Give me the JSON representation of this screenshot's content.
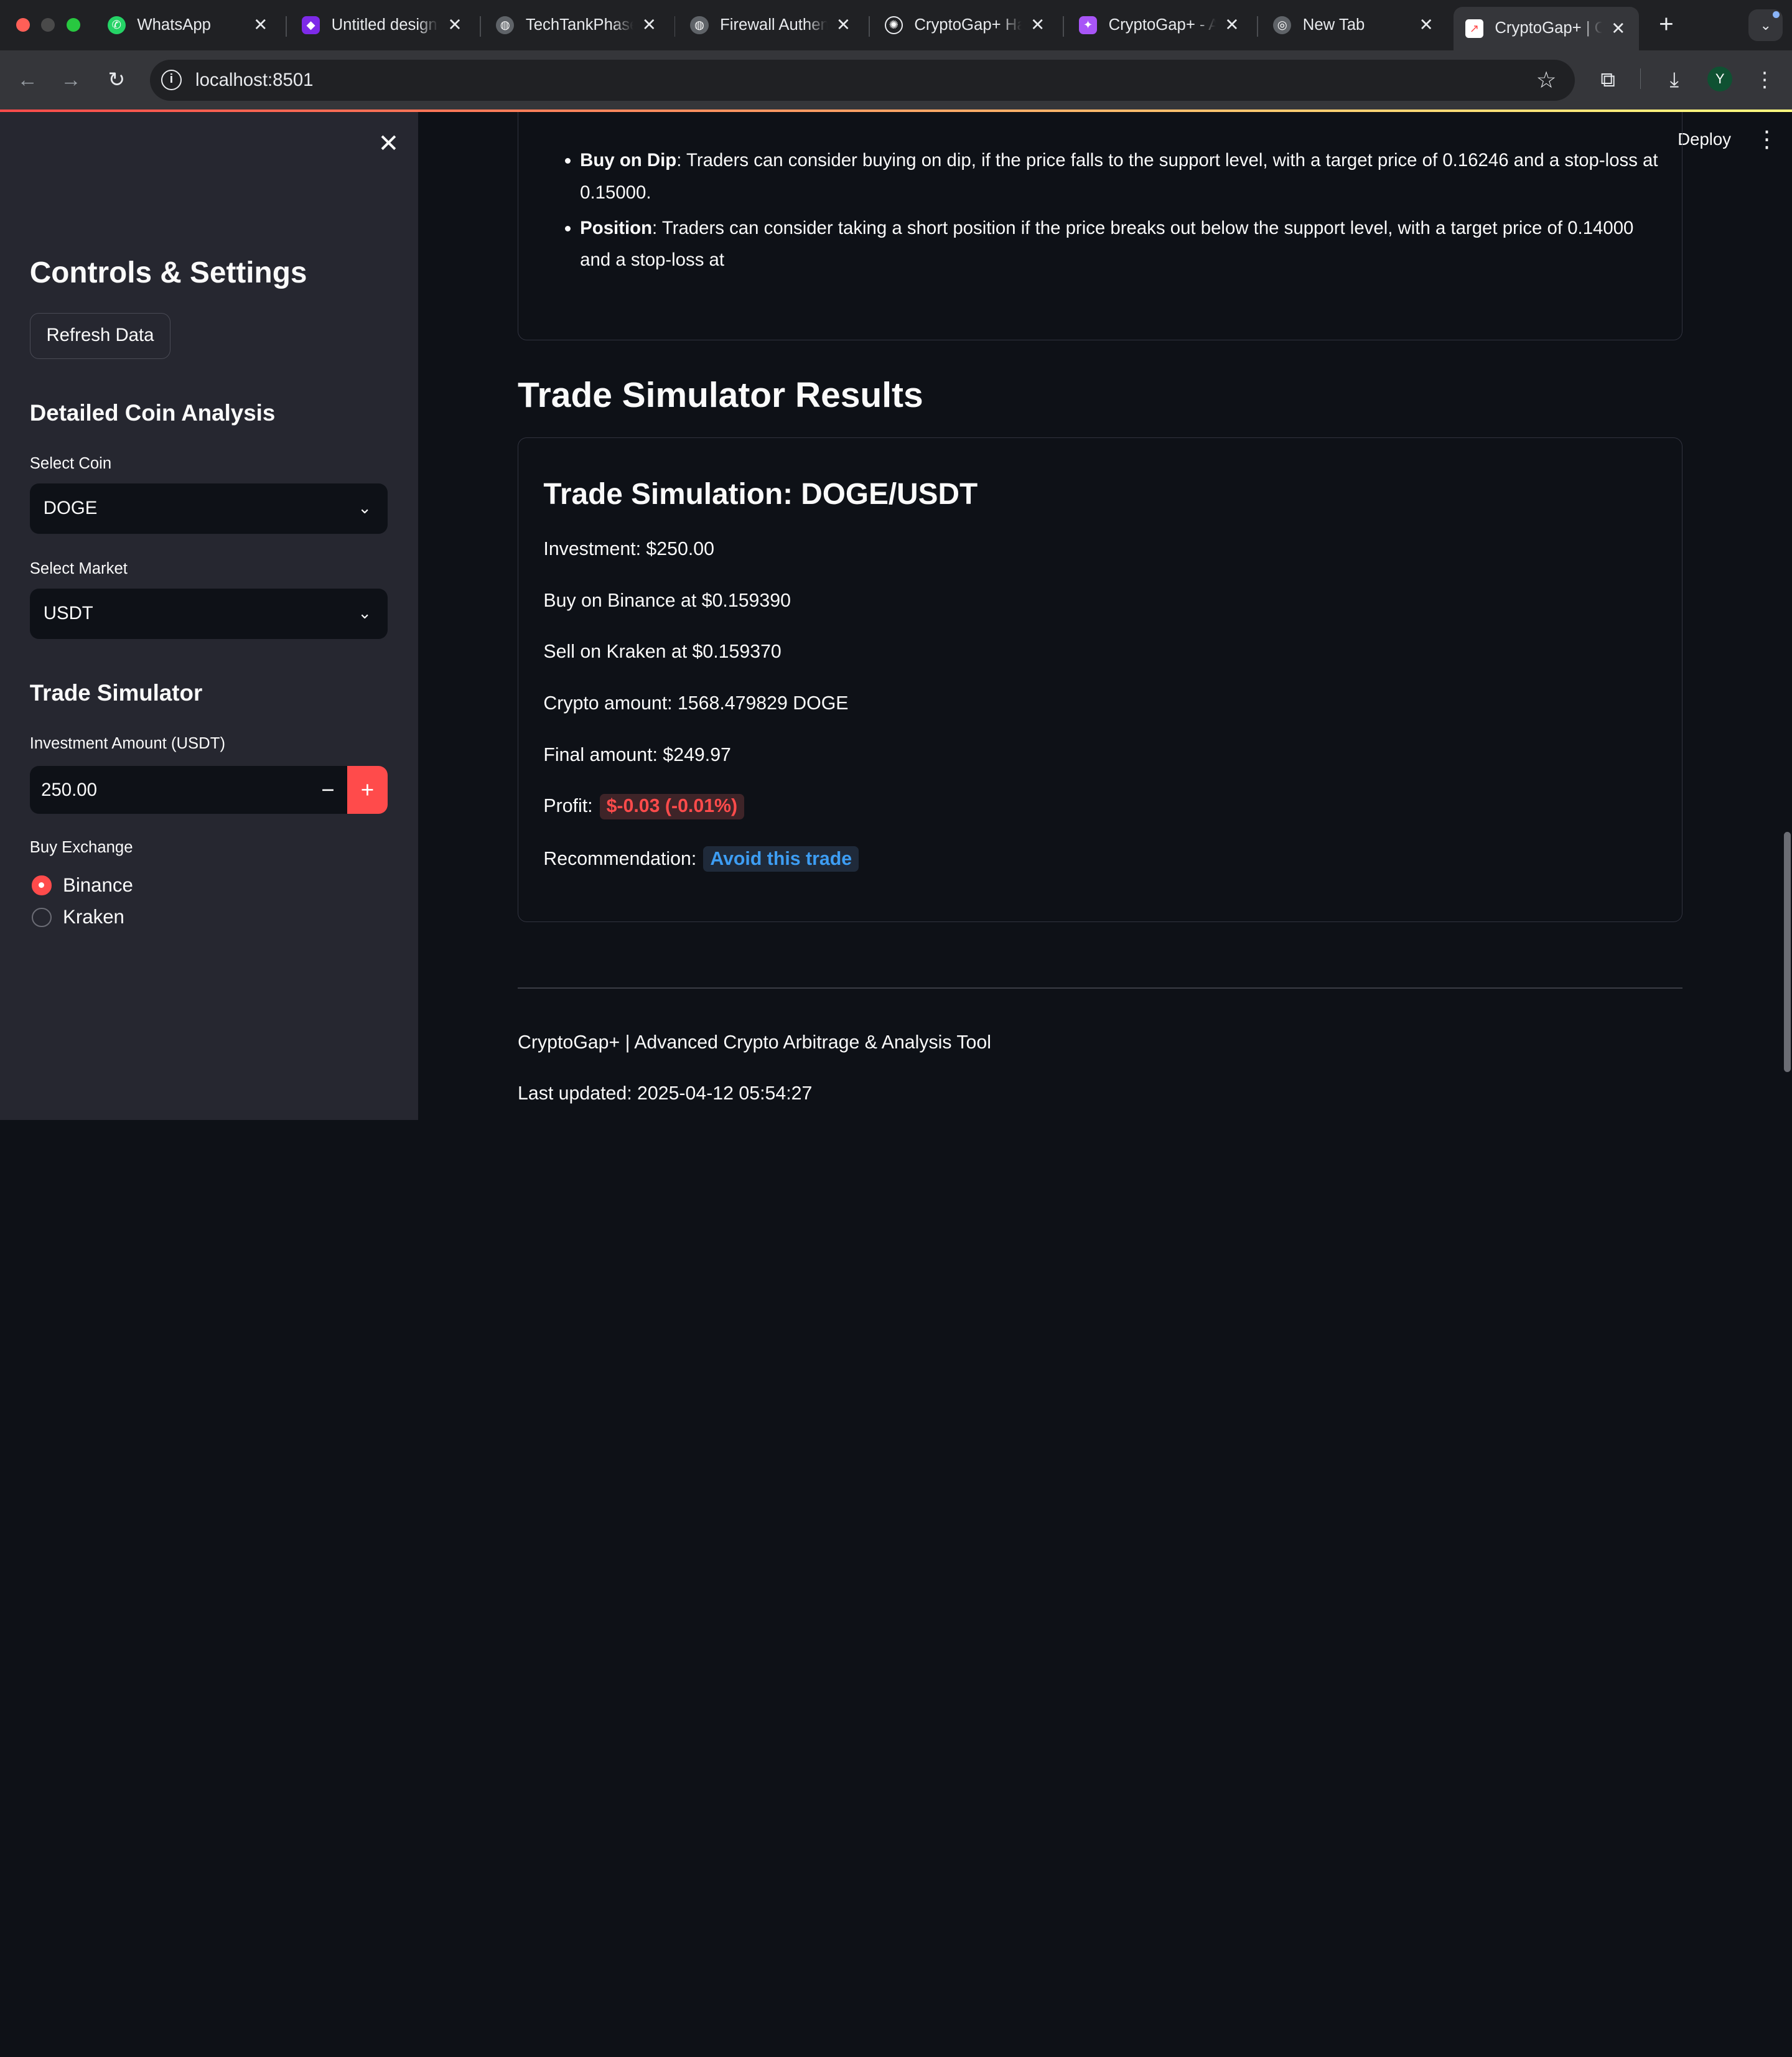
{
  "browser": {
    "tabs": [
      {
        "title": "WhatsApp",
        "icon": "whatsapp-icon",
        "color": "#25d366"
      },
      {
        "title": "Untitled design",
        "icon": "canva-icon",
        "color": "#7d2ae8"
      },
      {
        "title": "TechTankPhase",
        "icon": "globe-icon",
        "color": "#9aa0a6"
      },
      {
        "title": "Firewall Authen",
        "icon": "globe-icon",
        "color": "#9aa0a6"
      },
      {
        "title": "CryptoGap+ Ha",
        "icon": "openai-icon",
        "color": "#e8eaed"
      },
      {
        "title": "CryptoGap+ - A",
        "icon": "claude-icon",
        "color": "#a855f7"
      },
      {
        "title": "New Tab",
        "icon": "chrome-icon",
        "color": "#9aa0a6"
      },
      {
        "title": "CryptoGap+ | C",
        "icon": "chart-icon",
        "color": "#ff4b4b"
      }
    ],
    "url": "localhost:8501",
    "profile_initial": "Y"
  },
  "sidebar": {
    "title": "Controls & Settings",
    "refresh_label": "Refresh Data",
    "analysis_title": "Detailed Coin Analysis",
    "coin_label": "Select Coin",
    "coin_value": "DOGE",
    "market_label": "Select Market",
    "market_value": "USDT",
    "sim_title": "Trade Simulator",
    "investment_label": "Investment Amount (USDT)",
    "investment_value": "250.00",
    "buy_exchange_label": "Buy Exchange",
    "exchanges": [
      "Binance",
      "Kraken"
    ],
    "selected_exchange": "Binance"
  },
  "header": {
    "deploy_label": "Deploy"
  },
  "analysis": {
    "bullets": [
      {
        "label": "Buy on Dip",
        "text": ": Traders can consider buying on dip, if the price falls to the support level, with a target price of 0.16246 and a stop-loss at 0.15000."
      },
      {
        "label": "Position",
        "text": ": Traders can consider taking a short position if the price breaks out below the support level, with a target price of 0.14000 and a stop-loss at"
      }
    ]
  },
  "results": {
    "title": "Trade Simulator Results",
    "sim_heading": "Trade Simulation: DOGE/USDT",
    "investment": "Investment: $250.00",
    "buy": "Buy on Binance at $0.159390",
    "sell": "Sell on Kraken at $0.159370",
    "crypto_amount": "Crypto amount: 1568.479829 DOGE",
    "final_amount": "Final amount: $249.97",
    "profit_label": "Profit:",
    "profit_value": "$-0.03 (-0.01%)",
    "recommendation_label": "Recommendation:",
    "recommendation_value": "Avoid this trade"
  },
  "footer": {
    "tagline": "CryptoGap+ | Advanced Crypto Arbitrage & Analysis Tool",
    "updated": "Last updated: 2025-04-12 05:54:27"
  },
  "colors": {
    "accent": "#ff4b4b",
    "background": "#0e1117",
    "sidebar": "#262730",
    "recommendation": "#3d9df3"
  }
}
